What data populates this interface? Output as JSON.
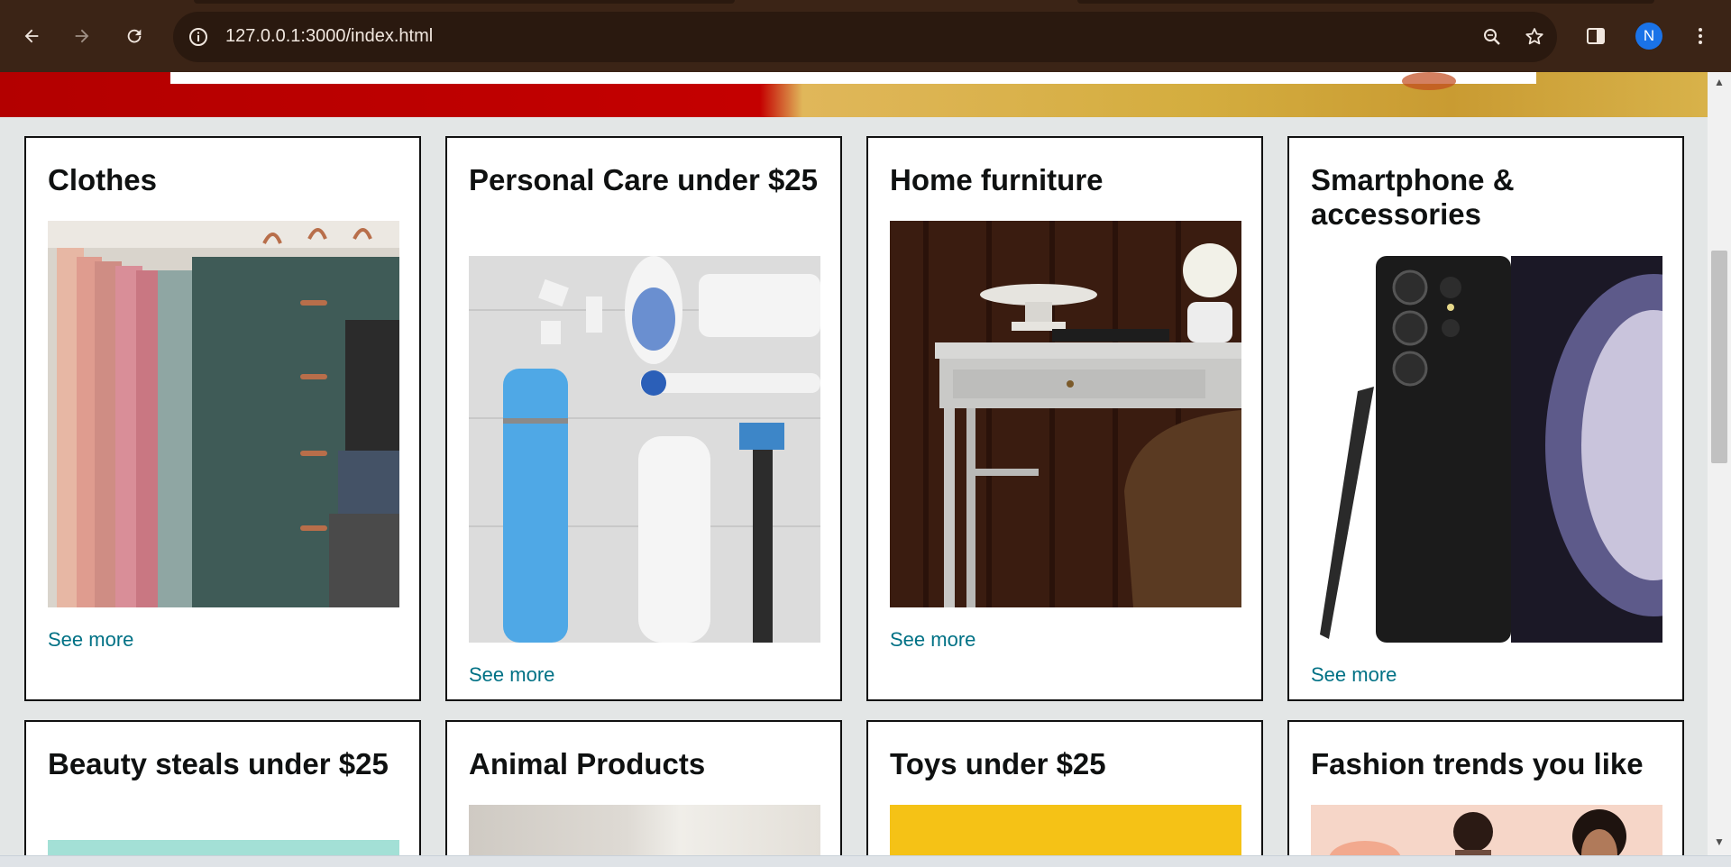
{
  "browser": {
    "url": "127.0.0.1:3000/index.html",
    "profile_initial": "N",
    "icons": {
      "back": "arrow-left-icon",
      "forward": "arrow-right-icon",
      "reload": "reload-icon",
      "site_info": "info-icon",
      "zoom": "zoom-icon",
      "bookmark": "star-icon",
      "side_panel": "side-panel-icon",
      "menu": "kebab-menu-icon"
    }
  },
  "cards": [
    {
      "title": "Clothes",
      "link": "See more",
      "image": "clothes-hangers-image"
    },
    {
      "title": "Personal Care under $25",
      "link": "See more",
      "image": "personal-care-items-image"
    },
    {
      "title": "Home furniture",
      "link": "See more",
      "image": "desk-furniture-image"
    },
    {
      "title": "Smartphone & accessories",
      "link": "See more",
      "image": "smartphone-image"
    },
    {
      "title": "Beauty steals under $25",
      "image": "beauty-image"
    },
    {
      "title": "Animal Products",
      "image": "animal-products-image"
    },
    {
      "title": "Toys under $25",
      "image": "toys-image"
    },
    {
      "title": "Fashion trends you like",
      "image": "fashion-image"
    }
  ],
  "colors": {
    "browser_frame": "#3b2416",
    "page_background": "#e3e6e6",
    "link": "#007185",
    "avatar": "#1a73e8"
  }
}
